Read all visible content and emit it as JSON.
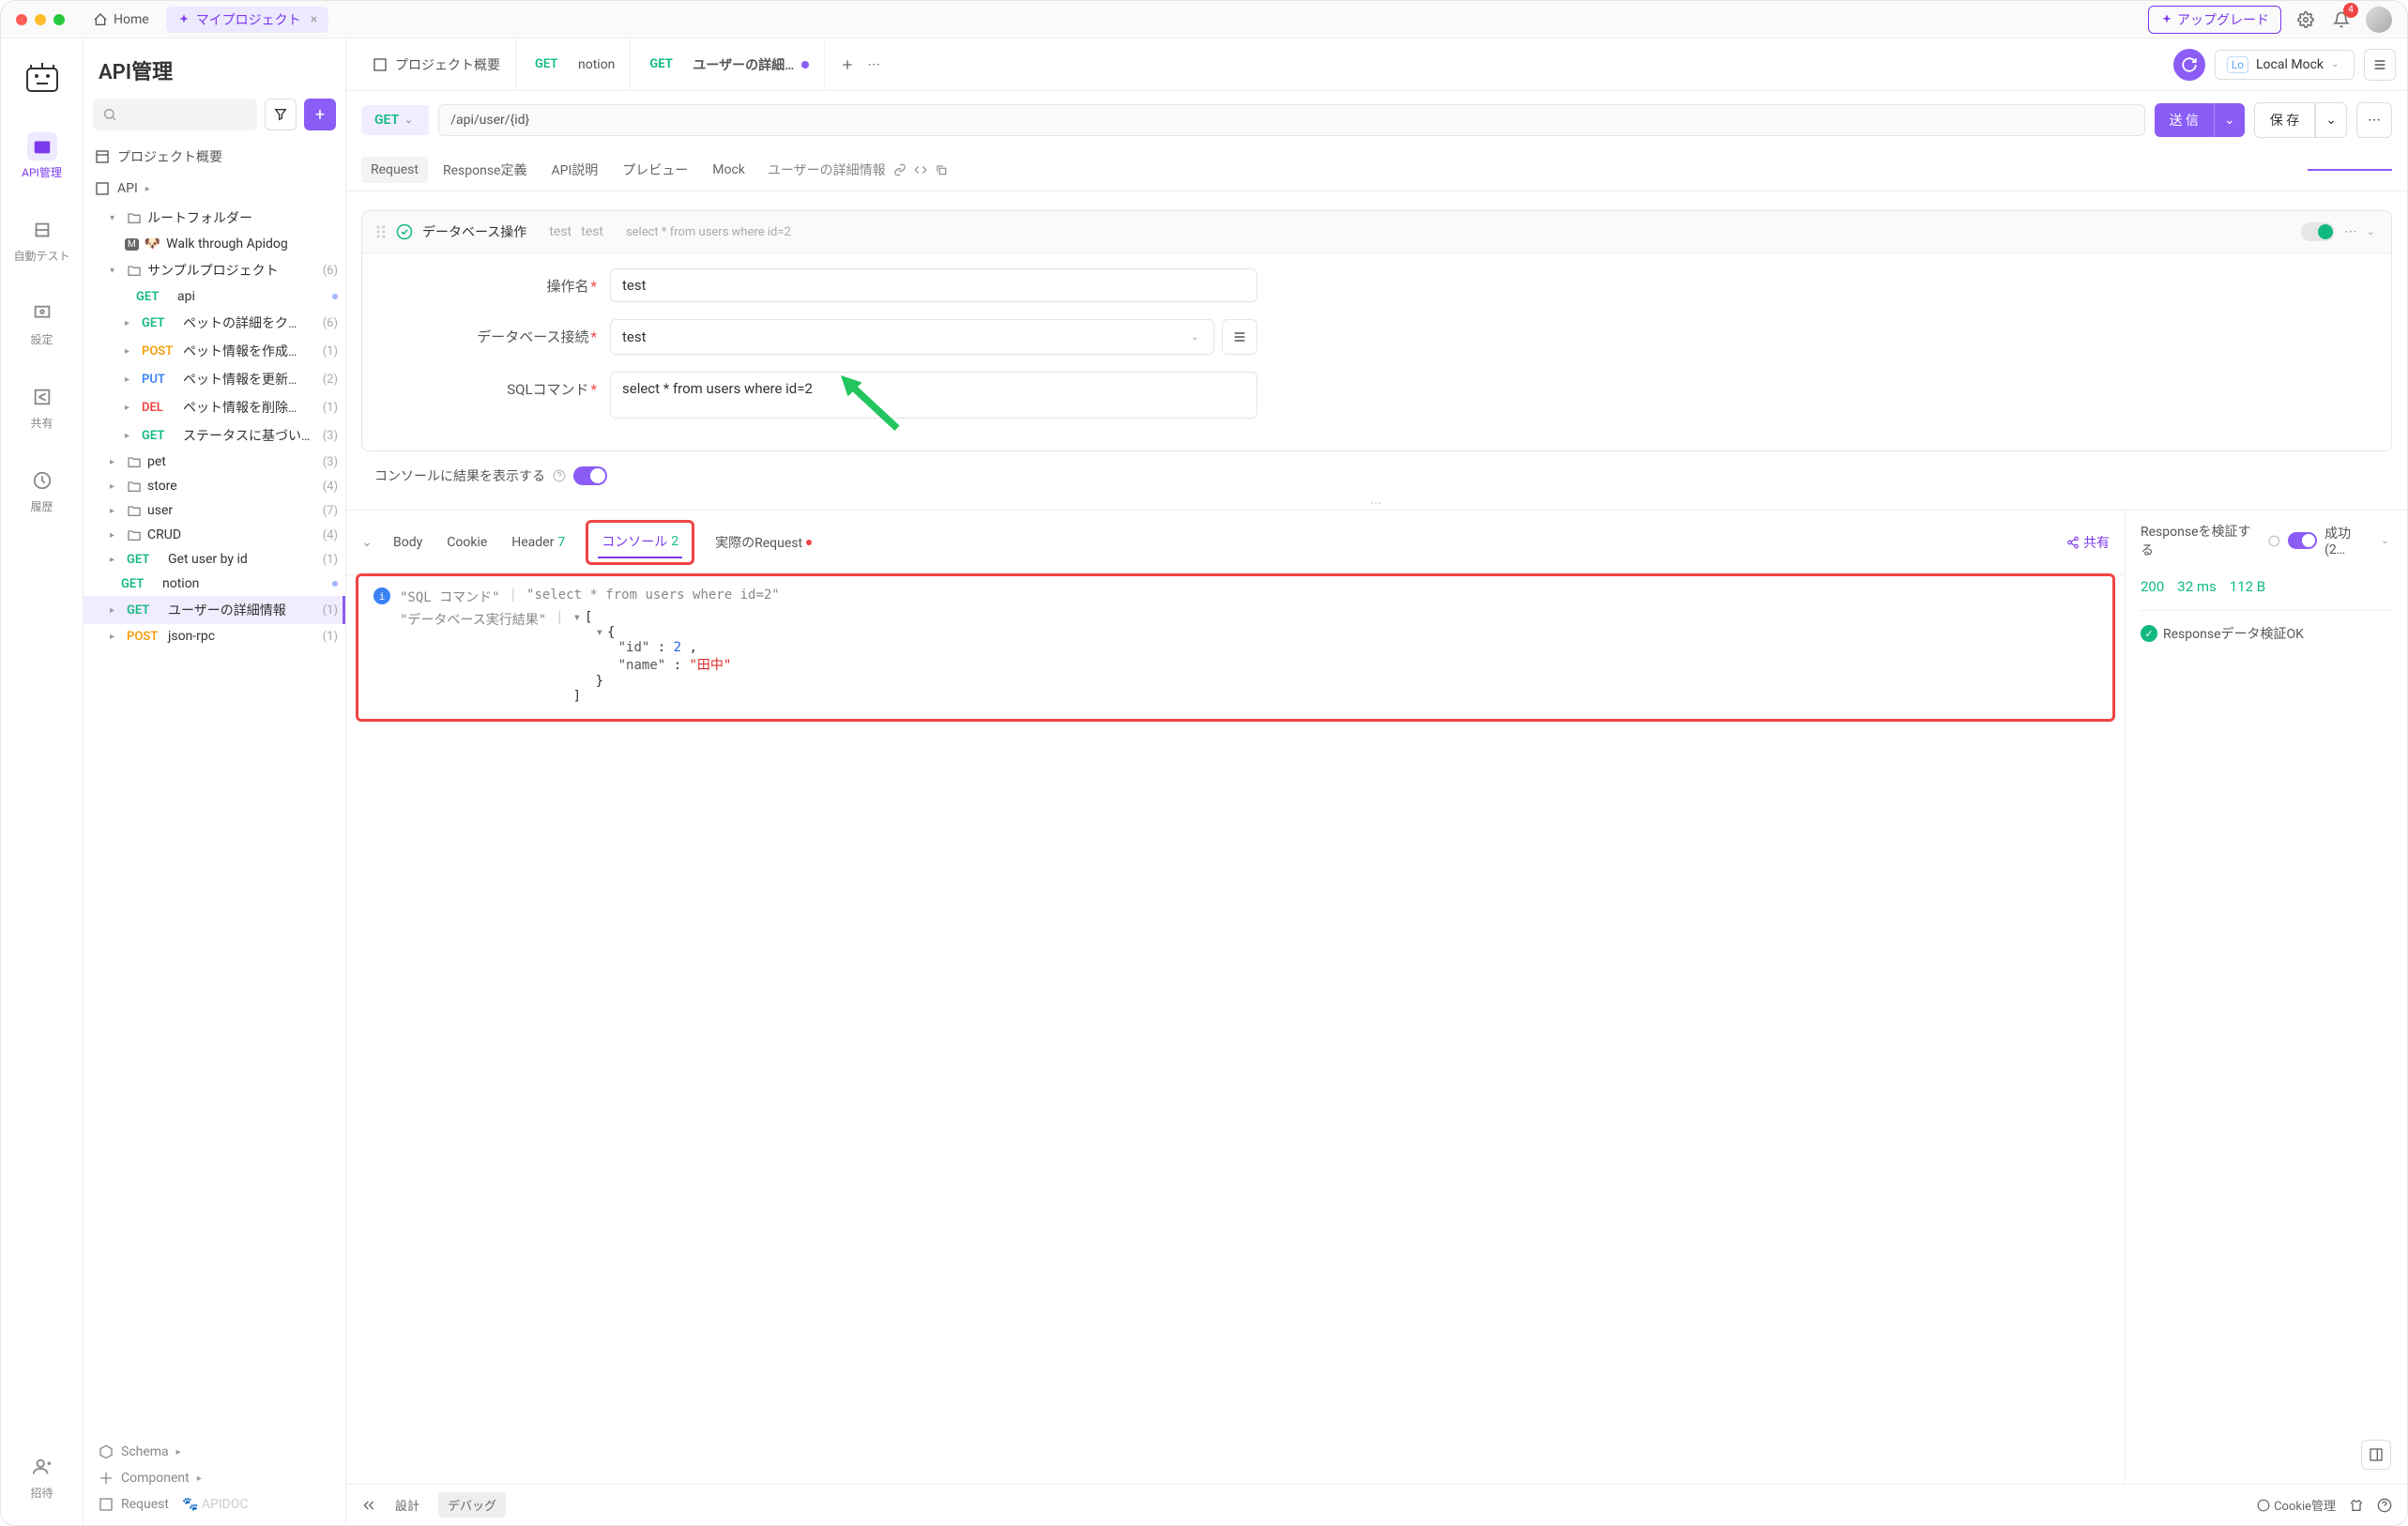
{
  "titlebar": {
    "home": "Home",
    "project_tab": "マイプロジェクト",
    "upgrade": "アップグレード",
    "notif_count": "4"
  },
  "rail": {
    "items": [
      "API管理",
      "自動テスト",
      "設定",
      "共有",
      "履歴"
    ],
    "invite": "招待"
  },
  "sidebar": {
    "title": "API管理",
    "project_overview": "プロジェクト概要",
    "api_root": "API",
    "tree": {
      "root_folder": "ルートフォルダー",
      "walk": "Walk through Apidog",
      "sample": "サンプルプロジェクト",
      "sample_count": "(6)",
      "api_item": "api",
      "pet_detail": "ペットの詳細をク…",
      "pet_detail_count": "(6)",
      "pet_create": "ペット情報を作成…",
      "pet_create_count": "(1)",
      "pet_update": "ペット情報を更新…",
      "pet_update_count": "(2)",
      "pet_delete": "ペット情報を削除…",
      "pet_delete_count": "(1)",
      "status": "ステータスに基づい…",
      "status_count": "(3)",
      "pet": "pet",
      "pet_count": "(3)",
      "store": "store",
      "store_count": "(4)",
      "user": "user",
      "user_count": "(7)",
      "crud": "CRUD",
      "crud_count": "(4)",
      "getuser": "Get user by id",
      "getuser_count": "(1)",
      "notion": "notion",
      "userdetail": "ユーザーの詳細情報",
      "userdetail_count": "(1)",
      "jsonrpc": "json-rpc",
      "jsonrpc_count": "(1)"
    },
    "footer": {
      "schema": "Schema",
      "component": "Component",
      "request": "Request"
    }
  },
  "tabs": {
    "overview": "プロジェクト概要",
    "notion": "notion",
    "userdetail": "ユーザーの詳細…",
    "env": "Local Mock"
  },
  "urlbar": {
    "method": "GET",
    "url": "/api/user/{id}",
    "send": "送 信",
    "save": "保 存"
  },
  "subtabs": {
    "request": "Request",
    "response": "Response定義",
    "apidoc": "API説明",
    "preview": "プレビュー",
    "mock": "Mock",
    "breadcrumb": "ユーザーの詳細情報"
  },
  "dbcard": {
    "title": "データベース操作",
    "tag1": "test",
    "tag2": "test",
    "sql_preview": "select * from users where id=2",
    "label_name": "操作名",
    "val_name": "test",
    "label_conn": "データベース接続",
    "val_conn": "test",
    "label_sql": "SQLコマンド",
    "val_sql": "select * from users where id=2",
    "console_toggle": "コンソールに結果を表示する"
  },
  "resp": {
    "body": "Body",
    "cookie": "Cookie",
    "header": "Header",
    "header_count": "7",
    "console": "コンソール",
    "console_count": "2",
    "actual": "実際のRequest",
    "share": "共有",
    "sql_label": "\"SQL コマンド\"",
    "sql_value": "\"select * from users where id=2\"",
    "exec_label": "\"データベース実行結果\"",
    "json_id_key": "\"id\"",
    "json_id_val": "2",
    "json_name_key": "\"name\"",
    "json_name_val": "\"田中\""
  },
  "resp_right": {
    "validate": "Responseを検証する",
    "success": "成功 (2…",
    "code": "200",
    "time": "32 ms",
    "size": "112 B",
    "ok_msg": "Responseデータ検証OK"
  },
  "footer": {
    "design": "設計",
    "debug": "デバッグ",
    "cookie": "Cookie管理"
  }
}
